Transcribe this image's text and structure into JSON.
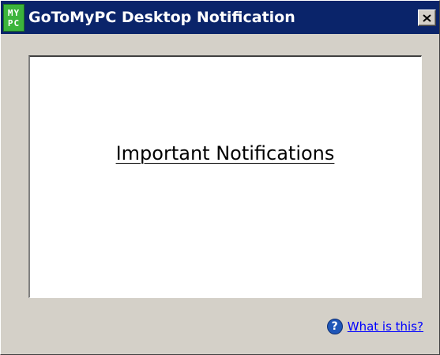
{
  "window": {
    "title": "GoToMyPC Desktop Notification",
    "logo": {
      "top": "MY",
      "bottom": "PC",
      "icon": "gotomypc-logo-icon"
    },
    "close_icon": "close-icon"
  },
  "content": {
    "heading": "Important Notifications"
  },
  "footer": {
    "help_icon": "question-circle-icon",
    "help_link": "What is this?"
  },
  "colors": {
    "titlebar": "#0a246a",
    "window_bg": "#d4d0c8",
    "logo_green": "#3cb43c",
    "link_blue": "#0000ff",
    "help_icon_blue": "#1f56b8"
  }
}
